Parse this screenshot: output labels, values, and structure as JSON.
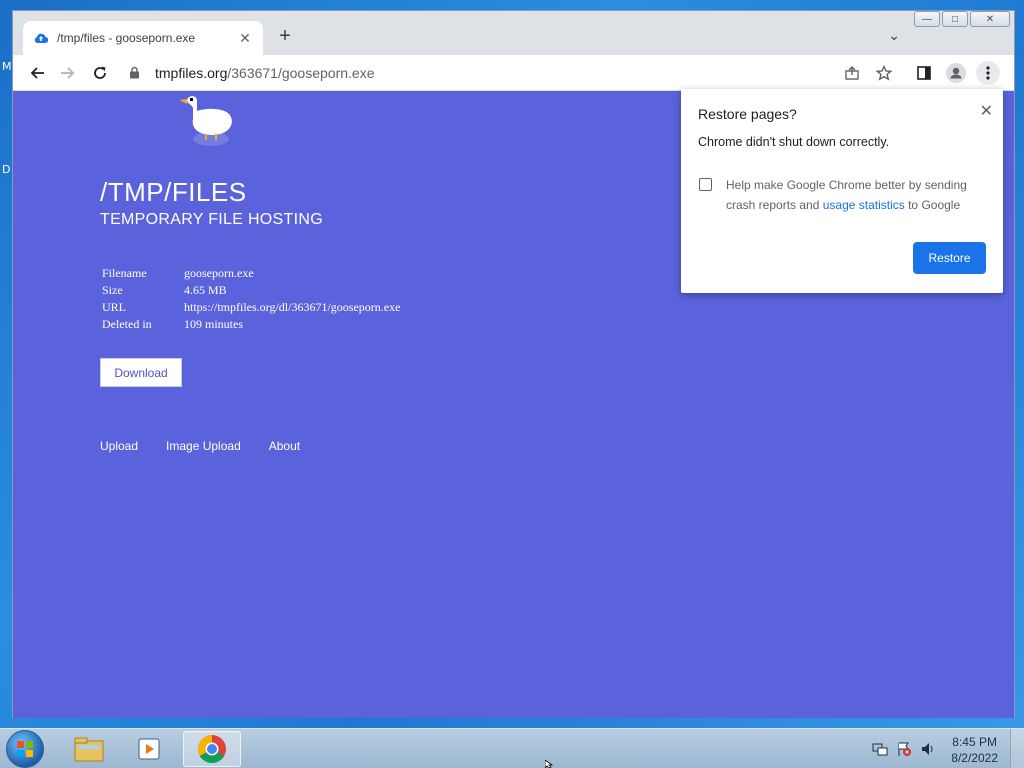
{
  "desktop": {
    "label_top": "M",
    "label_mid": "D"
  },
  "browser": {
    "tab": {
      "title": "/tmp/files - gooseporn.exe",
      "favicon": "cloud-upload-icon"
    },
    "window_controls": {
      "minimize": "—",
      "maximize": "□",
      "close": "✕"
    },
    "toolbar": {
      "url_host": "tmpfiles.org",
      "url_path": "/363671/gooseporn.exe"
    }
  },
  "page": {
    "title": "/TMP/FILES",
    "subtitle": "TEMPORARY FILE HOSTING",
    "file_info": [
      {
        "key": "Filename",
        "value": "gooseporn.exe"
      },
      {
        "key": "Size",
        "value": "4.65 MB"
      },
      {
        "key": "URL",
        "value": "https://tmpfiles.org/dl/363671/gooseporn.exe"
      },
      {
        "key": "Deleted in",
        "value": "109 minutes"
      }
    ],
    "download_label": "Download",
    "nav": {
      "upload": "Upload",
      "image_upload": "Image Upload",
      "about": "About"
    }
  },
  "restore_dialog": {
    "title": "Restore pages?",
    "message": "Chrome didn't shut down correctly.",
    "checkbox_text_before": "Help make Google Chrome better by sending crash reports and ",
    "checkbox_link": "usage statistics",
    "checkbox_text_after": " to Google",
    "checked": false,
    "button_label": "Restore"
  },
  "taskbar": {
    "apps": [
      "windows-explorer",
      "media-player",
      "google-chrome"
    ],
    "active_app": "google-chrome",
    "clock_time": "8:45 PM",
    "clock_date": "8/2/2022"
  },
  "colors": {
    "page_bg": "#5a63dc",
    "accent": "#1a73e8"
  }
}
